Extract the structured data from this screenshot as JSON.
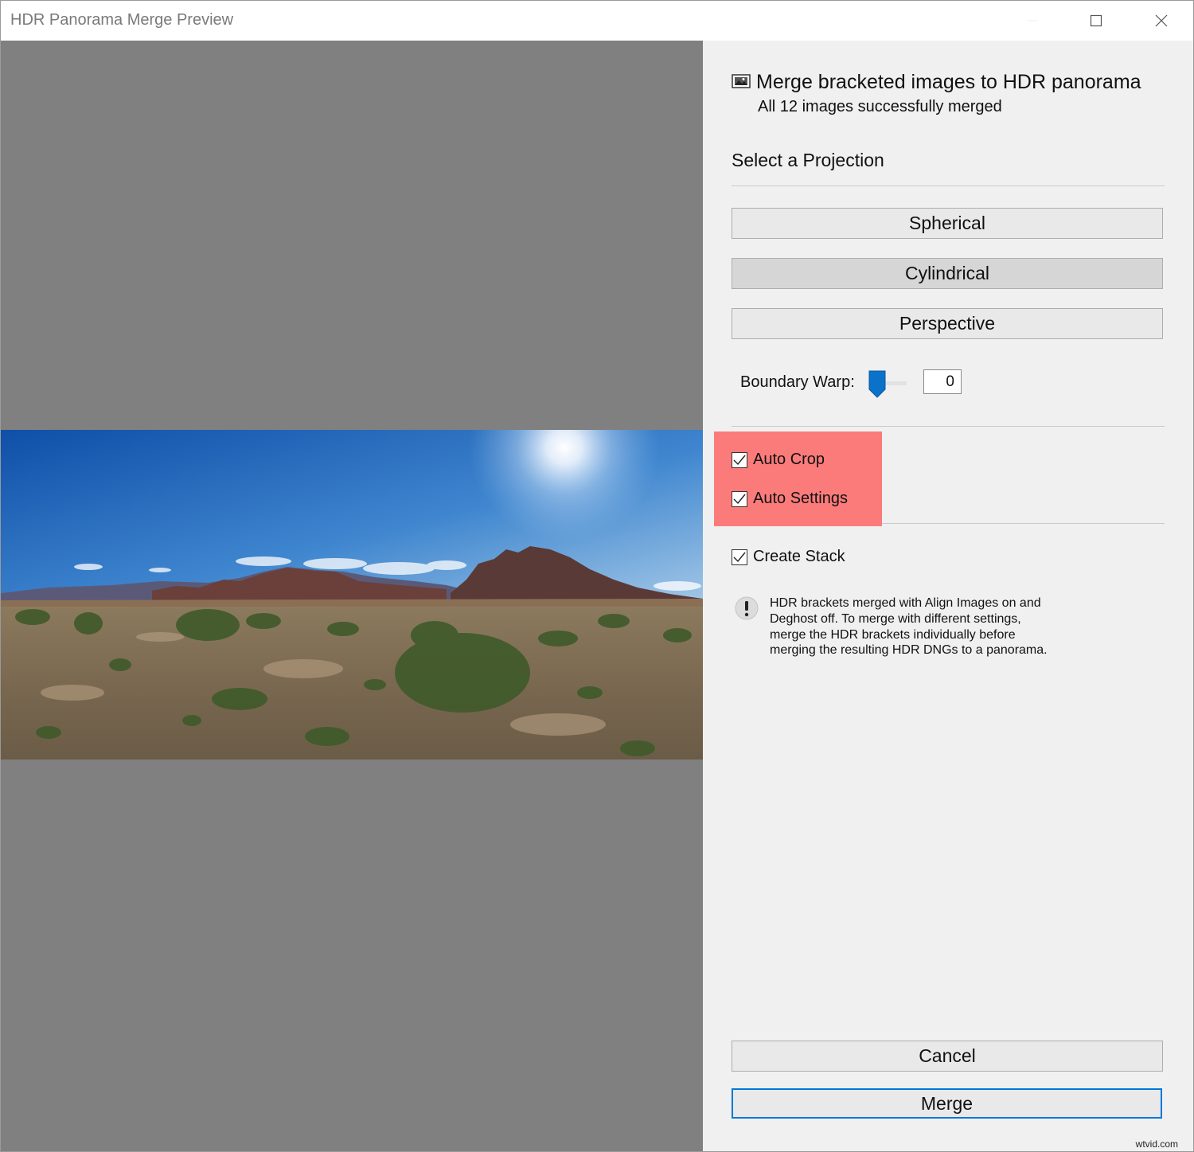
{
  "window": {
    "title": "HDR Panorama Merge Preview"
  },
  "panel": {
    "heading": "Merge bracketed images to HDR panorama",
    "subheading": "All 12 images successfully merged",
    "projection_label": "Select a Projection",
    "projections": [
      {
        "label": "Spherical",
        "selected": false
      },
      {
        "label": "Cylindrical",
        "selected": true
      },
      {
        "label": "Perspective",
        "selected": false
      }
    ],
    "boundary_warp": {
      "label": "Boundary Warp:",
      "value": "0"
    },
    "checkboxes": {
      "auto_crop": {
        "label": "Auto Crop",
        "checked": true
      },
      "auto_settings": {
        "label": "Auto Settings",
        "checked": true
      },
      "create_stack": {
        "label": "Create Stack",
        "checked": true
      }
    },
    "info_message": "HDR brackets merged with Align Images on and Deghost off. To merge with different settings, merge the HDR brackets individually before merging the resulting HDR DNGs to a panorama.",
    "cancel_label": "Cancel",
    "merge_label": "Merge"
  },
  "watermark": "wtvid.com",
  "colors": {
    "preview_bg": "#808080",
    "panel_bg": "#f0f0f0",
    "highlight": "#ff4d4d",
    "accent": "#0078d7"
  }
}
